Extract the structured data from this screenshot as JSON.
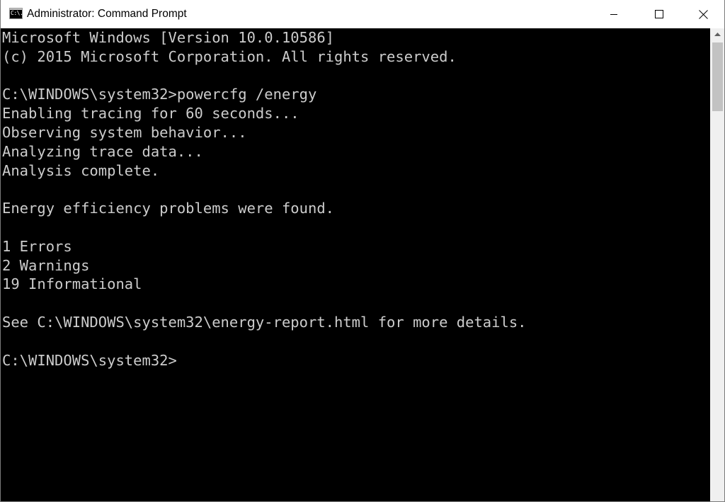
{
  "window": {
    "title": "Administrator: Command Prompt",
    "icon_text": "C:\\."
  },
  "console": {
    "lines": [
      "Microsoft Windows [Version 10.0.10586]",
      "(c) 2015 Microsoft Corporation. All rights reserved.",
      "",
      "C:\\WINDOWS\\system32>powercfg /energy",
      "Enabling tracing for 60 seconds...",
      "Observing system behavior...",
      "Analyzing trace data...",
      "Analysis complete.",
      "",
      "Energy efficiency problems were found.",
      "",
      "1 Errors",
      "2 Warnings",
      "19 Informational",
      "",
      "See C:\\WINDOWS\\system32\\energy-report.html for more details.",
      "",
      "C:\\WINDOWS\\system32>"
    ]
  },
  "colors": {
    "console_bg": "#000000",
    "console_text": "#cccccc",
    "titlebar_bg": "#ffffff"
  },
  "icons": {
    "minimize": "minimize-icon",
    "maximize": "maximize-icon",
    "close": "close-icon"
  }
}
